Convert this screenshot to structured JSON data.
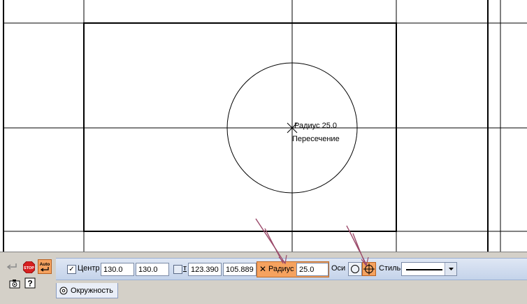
{
  "canvas": {
    "circle_label": "Радиус 25.0",
    "snap_label": "Пересечение"
  },
  "toolbar": {
    "center_label": "Центр",
    "center_x": "130.0",
    "center_y": "130.0",
    "point_label": "т",
    "point_x": "123.390",
    "point_y": "105.889",
    "radius_label": "Радиус",
    "radius_value": "25.0",
    "axes_label": "Оси",
    "style_label": "Стиль"
  },
  "tabs": [
    {
      "label": "Окружность"
    }
  ],
  "left_tools": {
    "stop_text": "STOP",
    "auto_text": "Auto"
  },
  "colors": {
    "highlight": "#f5a25f",
    "toolbar_bg": "#c4d3ea",
    "arrow": "#9b4a6a"
  },
  "icons": [
    "enter-arrow-icon",
    "stop-icon",
    "auto-icon",
    "camera-icon",
    "help-icon",
    "circle-axes-off-icon",
    "circle-axes-on-icon",
    "line-style-icon",
    "dropdown-arrow-icon",
    "circle-tab-icon"
  ]
}
